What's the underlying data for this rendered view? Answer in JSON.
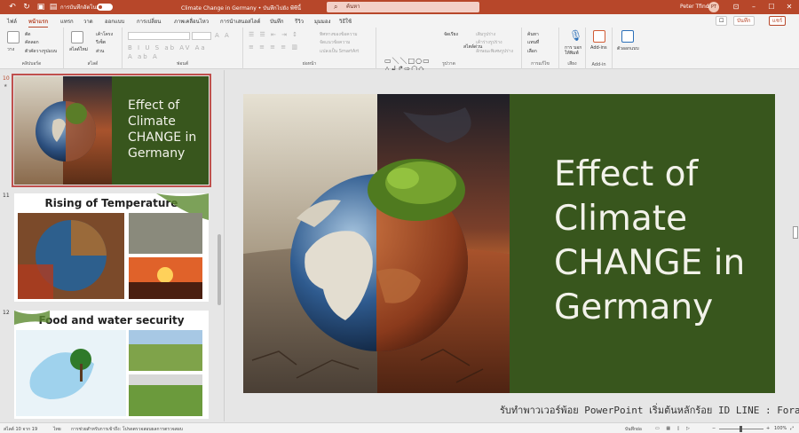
{
  "titlebar": {
    "autosave_label": "การบันทึกอัตโนมัติ",
    "doc_title": "Climate Change in Germany • บันทึกไปยัง พีซีนี้",
    "search_placeholder": "ค้นหา",
    "user_name": "Peter Tfind",
    "avatar_initials": "PT"
  },
  "tabs": [
    "ไฟล์",
    "หน้าแรก",
    "แทรก",
    "วาด",
    "ออกแบบ",
    "การเปลี่ยน",
    "ภาพเคลื่อนไหว",
    "การนำเสนอสไลด์",
    "บันทึก",
    "รีวิว",
    "มุมมอง",
    "วิธีใช้"
  ],
  "active_tab": "หน้าแรก",
  "tab_buttons": {
    "comment": "☐",
    "record": "บันทึก",
    "share": "แชร์"
  },
  "ribbon": {
    "clipboard": {
      "paste": "วาง",
      "cut": "ตัด",
      "copy": "คัดลอก",
      "format_painter": "ตัวคัดวางรูปแบบ",
      "label": "คลิปบอร์ด"
    },
    "slides": {
      "new_slide": "สไลด์ใหม่",
      "layout": "เค้าโครง",
      "reset": "รีเซ็ต",
      "section": "ส่วน",
      "label": "สไลด์"
    },
    "font": {
      "label": "ฟอนต์"
    },
    "paragraph": {
      "text_direction": "ทิศทางของข้อความ",
      "align_text": "จัดแนวข้อความ",
      "smartart": "แปลงเป็น SmartArt",
      "label": "ย่อหน้า"
    },
    "drawing": {
      "arrange": "จัดเรียง",
      "quick_styles": "สไตล์ด่วน",
      "shape_fill": "เติมรูปร่าง",
      "shape_outline": "เค้าร่างรูปร่าง",
      "shape_effects": "ลักษณะพิเศษรูปร่าง",
      "label": "รูปวาด"
    },
    "editing": {
      "find": "ค้นหา",
      "replace": "แทนที่",
      "select": "เลือก",
      "label": "การแก้ไข"
    },
    "voice": {
      "dictate": "การ บอกให้พิมพ์",
      "label": "เสียง"
    },
    "addins": {
      "addins": "Add-ins",
      "label": "Add-in"
    },
    "designer": {
      "designer": "ตัวออกแบบ"
    }
  },
  "thumbnails": [
    {
      "number": "10",
      "title": "Effect of Climate CHANGE in Germany",
      "selected": true
    },
    {
      "number": "11",
      "title": "Rising of Temperature",
      "selected": false
    },
    {
      "number": "12",
      "title": "Food and water security",
      "selected": false
    }
  ],
  "slide": {
    "title_lines": [
      "Effect of",
      "Climate",
      "CHANGE in",
      "Germany"
    ],
    "bg_color": "#38561d"
  },
  "watermark": "รับทำพาวเวอร์พ้อย PowerPoint เริ่มต้นหลักร้อย ID LINE : Forartwork",
  "status": {
    "slide_count": "สไลด์ 10 จาก 19",
    "language": "ไทย",
    "accessibility": "การช่วยสำหรับการเข้าถึง: โปรดตรวจสอบผลการตรวจสอบ",
    "notes": "บันทึกย่อ",
    "zoom": "100%"
  },
  "colors": {
    "accent": "#b7472a",
    "slide_green": "#38561d"
  }
}
